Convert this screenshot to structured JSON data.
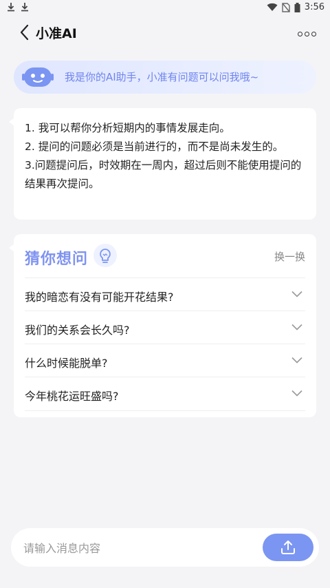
{
  "status": {
    "time": "3:56",
    "icons": [
      "download-icon",
      "download-icon",
      "wifi-icon",
      "no-sim-icon",
      "battery-icon"
    ]
  },
  "header": {
    "title": "小准AI",
    "back_icon": "chevron-left-icon",
    "more_icon": "more-dots-icon"
  },
  "banner": {
    "text": "我是你的AI助手，小准有问题可以问我哦~",
    "icon": "robot-icon"
  },
  "intro": {
    "lines": [
      "1. 我可以帮你分析短期内的事情发展走向。",
      "2. 提问的问题必须是当前进行的，而不是尚未发生的。",
      "3.问题提问后，时效期在一周内，超过后则不能使用提问的结果再次提问。"
    ]
  },
  "guess": {
    "title": "猜你想问",
    "refresh_label": "换一换",
    "icon": "lightbulb-icon",
    "questions": [
      "我的暗恋有没有可能开花结果?",
      "我们的关系会长久吗?",
      "什么时候能脱单?",
      "今年桃花运旺盛吗?"
    ]
  },
  "composer": {
    "placeholder": "请输入消息内容",
    "send_icon": "upload-icon"
  },
  "colors": {
    "accent": "#7b95f2",
    "banner_text": "#6f84ee",
    "background": "#f4f4f6"
  }
}
